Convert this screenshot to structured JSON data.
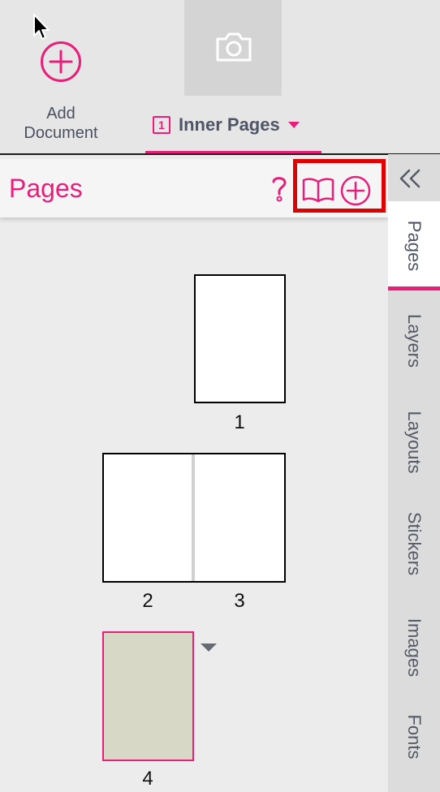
{
  "toolbar": {
    "add_document_label": "Add\nDocument",
    "camera_icon": "camera-icon",
    "tab": {
      "number": "1",
      "label": "Inner Pages"
    }
  },
  "panel": {
    "title": "Pages",
    "icons": [
      "help-icon",
      "book-icon",
      "add-page-icon"
    ]
  },
  "side_tabs": [
    "Pages",
    "Layers",
    "Layouts",
    "Stickers",
    "Images",
    "Fonts"
  ],
  "side_tabs_active": "Pages",
  "pages": {
    "p1": "1",
    "p2": "2",
    "p3": "3",
    "p4": "4"
  },
  "colors": {
    "accent": "#e91e7a",
    "highlight": "#e00000",
    "selected_page_fill": "#d8d8c6"
  }
}
